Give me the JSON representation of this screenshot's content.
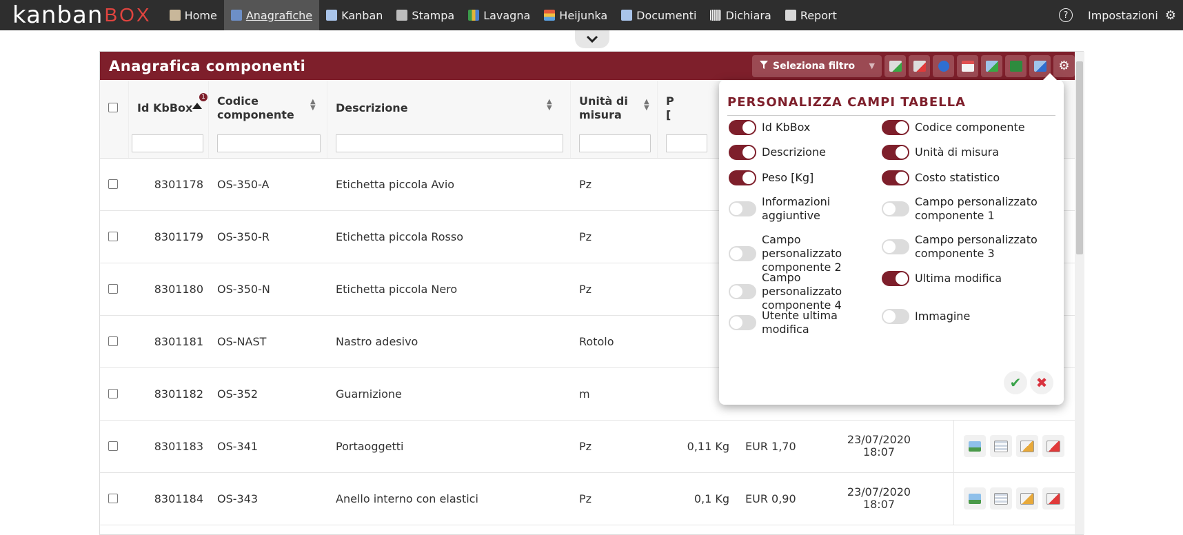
{
  "app": {
    "logo_main": "kanban",
    "logo_accent": "BOX"
  },
  "nav": {
    "items": [
      {
        "label": "Home",
        "icon": "home-icon"
      },
      {
        "label": "Anagrafiche",
        "icon": "table-icon"
      },
      {
        "label": "Kanban",
        "icon": "document-icon"
      },
      {
        "label": "Stampa",
        "icon": "printer-icon"
      },
      {
        "label": "Lavagna",
        "icon": "board-icon"
      },
      {
        "label": "Heijunka",
        "icon": "heijunka-icon"
      },
      {
        "label": "Documenti",
        "icon": "document-icon"
      },
      {
        "label": "Dichiara",
        "icon": "barcode-icon"
      },
      {
        "label": "Report",
        "icon": "report-icon"
      }
    ],
    "active": "Anagrafiche",
    "help_glyph": "?",
    "settings_label": "Impostazioni"
  },
  "panel": {
    "title": "Anagrafica componenti",
    "filter_placeholder": "Seleziona filtro"
  },
  "table": {
    "columns": {
      "id": "Id KbBox",
      "code": "Codice componente",
      "desc": "Descrizione",
      "unit": "Unità di misura",
      "peso_partial": "P",
      "peso_partial2": "["
    },
    "sort_badge": "1",
    "rows": [
      {
        "id": "8301178",
        "code": "OS-350-A",
        "desc": "Etichetta piccola Avio",
        "unit": "Pz",
        "peso": "",
        "costo": "",
        "date": "",
        "time": ""
      },
      {
        "id": "8301179",
        "code": "OS-350-R",
        "desc": "Etichetta piccola Rosso",
        "unit": "Pz",
        "peso": "",
        "costo": "",
        "date": "",
        "time": ""
      },
      {
        "id": "8301180",
        "code": "OS-350-N",
        "desc": "Etichetta piccola Nero",
        "unit": "Pz",
        "peso": "",
        "costo": "",
        "date": "",
        "time": ""
      },
      {
        "id": "8301181",
        "code": "OS-NAST",
        "desc": "Nastro adesivo",
        "unit": "Rotolo",
        "peso": "",
        "costo": "",
        "date": "",
        "time": ""
      },
      {
        "id": "8301182",
        "code": "OS-352",
        "desc": "Guarnizione",
        "unit": "m",
        "peso": "",
        "costo": "",
        "date": "",
        "time": ""
      },
      {
        "id": "8301183",
        "code": "OS-341",
        "desc": "Portaoggetti",
        "unit": "Pz",
        "peso": "0,11 Kg",
        "costo": "EUR 1,70",
        "date": "23/07/2020",
        "time": "18:07"
      },
      {
        "id": "8301184",
        "code": "OS-343",
        "desc": "Anello interno con elastici",
        "unit": "Pz",
        "peso": "0,1 Kg",
        "costo": "EUR 0,90",
        "date": "23/07/2020",
        "time": "18:07"
      }
    ]
  },
  "popover": {
    "title": "PERSONALIZZA CAMPI TABELLA",
    "options": [
      {
        "label": "Id KbBox",
        "on": true
      },
      {
        "label": "Codice componente",
        "on": true
      },
      {
        "label": "Descrizione",
        "on": true
      },
      {
        "label": "Unità di misura",
        "on": true
      },
      {
        "label": "Peso [Kg]",
        "on": true
      },
      {
        "label": "Costo statistico",
        "on": true
      },
      {
        "label": "Informazioni aggiuntive",
        "on": false
      },
      {
        "label": "Campo personalizzato componente 1",
        "on": false
      },
      {
        "label": "Campo personalizzato componente 2",
        "on": false
      },
      {
        "label": "Campo personalizzato componente 3",
        "on": false
      },
      {
        "label": "Campo personalizzato componente 4",
        "on": false
      },
      {
        "label": "Ultima modifica",
        "on": true
      },
      {
        "label": "Utente ultima modifica",
        "on": false
      },
      {
        "label": "Immagine",
        "on": false
      }
    ],
    "confirm_glyph": "✔",
    "cancel_glyph": "✖"
  },
  "colors": {
    "brand": "#7e1f2b",
    "navbar": "#2e2e2e",
    "logo_accent": "#e0443f",
    "confirm": "#3aa34a",
    "cancel": "#d9333f"
  }
}
